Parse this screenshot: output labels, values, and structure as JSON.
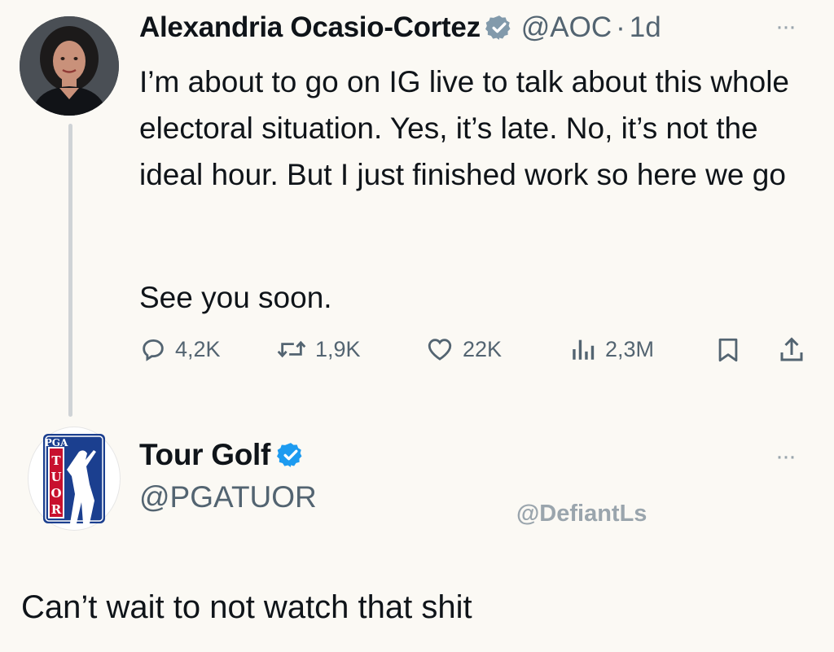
{
  "tweet": {
    "author": {
      "display_name": "Alexandria Ocasio-Cortez",
      "verified_type": "gray-check",
      "handle": "@AOC",
      "separator": "·",
      "time": "1d"
    },
    "more_glyph": "···",
    "text_paragraph_1": "I’m about to go on IG live to talk about this whole electoral situation. Yes, it’s late. No, it’s not the ideal hour. But I just finished work so here we go",
    "text_paragraph_2": "See you soon.",
    "stats": {
      "replies": "4,2K",
      "retweets": "1,9K",
      "likes": "22K",
      "views": "2,3M"
    },
    "icons": [
      "reply-icon",
      "retweet-icon",
      "like-icon",
      "views-icon",
      "bookmark-icon",
      "share-icon"
    ]
  },
  "reply": {
    "author": {
      "display_name": "Tour Golf",
      "verified_type": "blue-check",
      "handle": "@PGATUOR"
    },
    "avatar_logo": {
      "top_text": "PGA",
      "vertical_text": "TUOR"
    },
    "more_glyph": "···"
  },
  "watermark": "@DefiantLs",
  "caption": "Can’t wait to not watch that shit",
  "colors": {
    "background": "#fbf9f4",
    "text": "#0f1419",
    "secondary": "#536471",
    "blue_check": "#1d9bf0",
    "gray_check": "#829aab",
    "pga_blue": "#1b3f8f",
    "pga_red": "#c8102e"
  }
}
